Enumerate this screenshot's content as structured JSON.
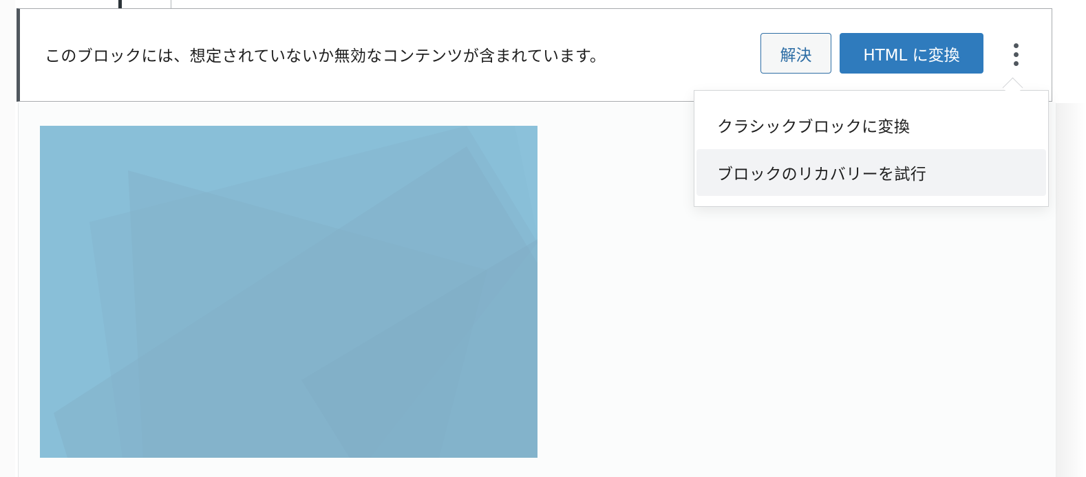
{
  "warning": {
    "message": "このブロックには、想定されていないか無効なコンテンツが含まれています。",
    "resolve_label": "解決",
    "convert_html_label": "HTML に変換",
    "more_icon": "more-vertical-icon"
  },
  "dropdown": {
    "items": [
      {
        "label": "クラシックブロックに変換"
      },
      {
        "label": "ブロックのリカバリーを試行"
      }
    ]
  },
  "colors": {
    "primary": "#2f7bbd",
    "notice_border": "#50575e",
    "image_base": "#89bfd8"
  }
}
